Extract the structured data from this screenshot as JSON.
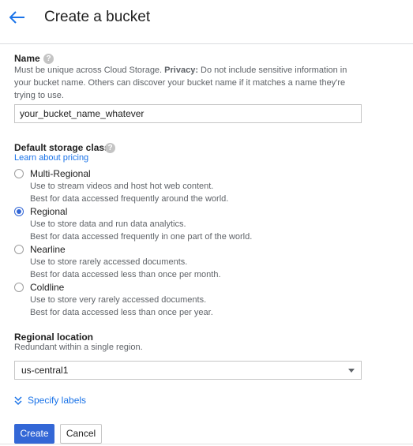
{
  "header": {
    "title": "Create a bucket"
  },
  "name_section": {
    "label": "Name",
    "help_icon": "?",
    "description_prefix": "Must be unique across Cloud Storage. ",
    "description_bold": "Privacy:",
    "description_suffix": " Do not include sensitive information in your bucket name. Others can discover your bucket name if it matches a name they're trying to use.",
    "input_value": "your_bucket_name_whatever"
  },
  "storage_class": {
    "label": "Default storage class",
    "help_icon": "?",
    "pricing_link": "Learn about pricing",
    "options": [
      {
        "label": "Multi-Regional",
        "desc1": "Use to stream videos and host hot web content.",
        "desc2": "Best for data accessed frequently around the world.",
        "selected": false
      },
      {
        "label": "Regional",
        "desc1": "Use to store data and run data analytics.",
        "desc2": "Best for data accessed frequently in one part of the world.",
        "selected": true
      },
      {
        "label": "Nearline",
        "desc1": "Use to store rarely accessed documents.",
        "desc2": "Best for data accessed less than once per month.",
        "selected": false
      },
      {
        "label": "Coldline",
        "desc1": "Use to store very rarely accessed documents.",
        "desc2": "Best for data accessed less than once per year.",
        "selected": false
      }
    ]
  },
  "location": {
    "label": "Regional location",
    "description": "Redundant within a single region.",
    "selected_value": "us-central1"
  },
  "labels": {
    "toggle_label": "Specify labels"
  },
  "actions": {
    "create_label": "Create",
    "cancel_label": "Cancel"
  },
  "colors": {
    "accent": "#3367d6",
    "link": "#1a73e8"
  }
}
